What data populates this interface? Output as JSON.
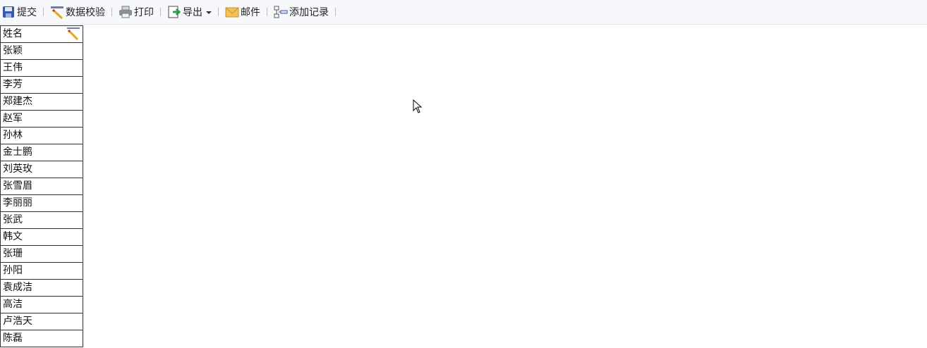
{
  "toolbar": {
    "items": [
      {
        "label": "提交",
        "icon": "save-icon"
      },
      {
        "label": "数据校验",
        "icon": "ruler-pencil-icon"
      },
      {
        "label": "打印",
        "icon": "printer-icon"
      },
      {
        "label": "导出",
        "icon": "export-icon"
      },
      {
        "label": "邮件",
        "icon": "mail-icon"
      },
      {
        "label": "添加记录",
        "icon": "add-record-icon"
      }
    ]
  },
  "table": {
    "header": "姓名",
    "rows": [
      "张颖",
      "王伟",
      "李芳",
      "郑建杰",
      "赵军",
      "孙林",
      "金士鹏",
      "刘英玫",
      "张雪眉",
      "李丽丽",
      "张武",
      "韩文",
      "张珊",
      "孙阳",
      "袁成洁",
      "高洁",
      "卢浩天",
      "陈磊"
    ]
  }
}
